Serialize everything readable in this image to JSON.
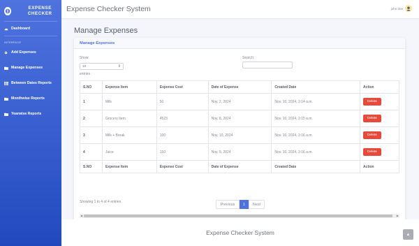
{
  "app": {
    "brand": "EXPENSE CHECKER",
    "topbar_title": "Expense Checker System",
    "user_name": "john doe",
    "footer_text": "Expense Checker System"
  },
  "sidebar": {
    "dashboard": "Dashboard",
    "heading": "INTERFACE",
    "items": [
      {
        "label": "Add Expenses",
        "icon": "gear-icon"
      },
      {
        "label": "Manage Expenses",
        "icon": "folder-icon"
      },
      {
        "label": "Between Dates Reports",
        "icon": "table-icon"
      },
      {
        "label": "Monthwise Reports",
        "icon": "folder-icon"
      },
      {
        "label": "Yearwise Reports",
        "icon": "folder-icon"
      }
    ]
  },
  "page": {
    "title": "Manage Expenses",
    "card_title": "Manage Expenses"
  },
  "controls": {
    "show_label": "Show",
    "show_value": "10",
    "entries_label": "entries",
    "search_label": "Search:",
    "search_value": ""
  },
  "table": {
    "headers": [
      "S.NO",
      "Expense Item",
      "Expense Cost",
      "Date of Expense",
      "Created Date",
      "Action"
    ],
    "rows": [
      {
        "sno": "1",
        "item": "Milk",
        "cost": "50",
        "date": "Nov. 2, 2024",
        "created": "Nov. 10, 2024, 3:14 a.m.",
        "action": "Delete"
      },
      {
        "sno": "2",
        "item": "Grocery Item",
        "cost": "4523",
        "date": "Nov. 8, 2024",
        "created": "Nov. 10, 2024, 3:15 a.m.",
        "action": "Delete"
      },
      {
        "sno": "3",
        "item": "Milk + Break",
        "cost": "100",
        "date": "Nov. 10, 2024",
        "created": "Nov. 10, 2024, 3:16 a.m.",
        "action": "Delete"
      },
      {
        "sno": "4",
        "item": "Juice",
        "cost": "150",
        "date": "Nov. 9, 2024",
        "created": "Nov. 10, 2024, 3:16 a.m.",
        "action": "Delete"
      }
    ]
  },
  "pagination": {
    "info": "Showing 1 to 4 of 4 entries",
    "previous": "Previous",
    "current": "1",
    "next": "Next"
  },
  "colors": {
    "sidebar": "#4e73df",
    "accent": "#4e73df",
    "danger": "#e74a3b"
  }
}
